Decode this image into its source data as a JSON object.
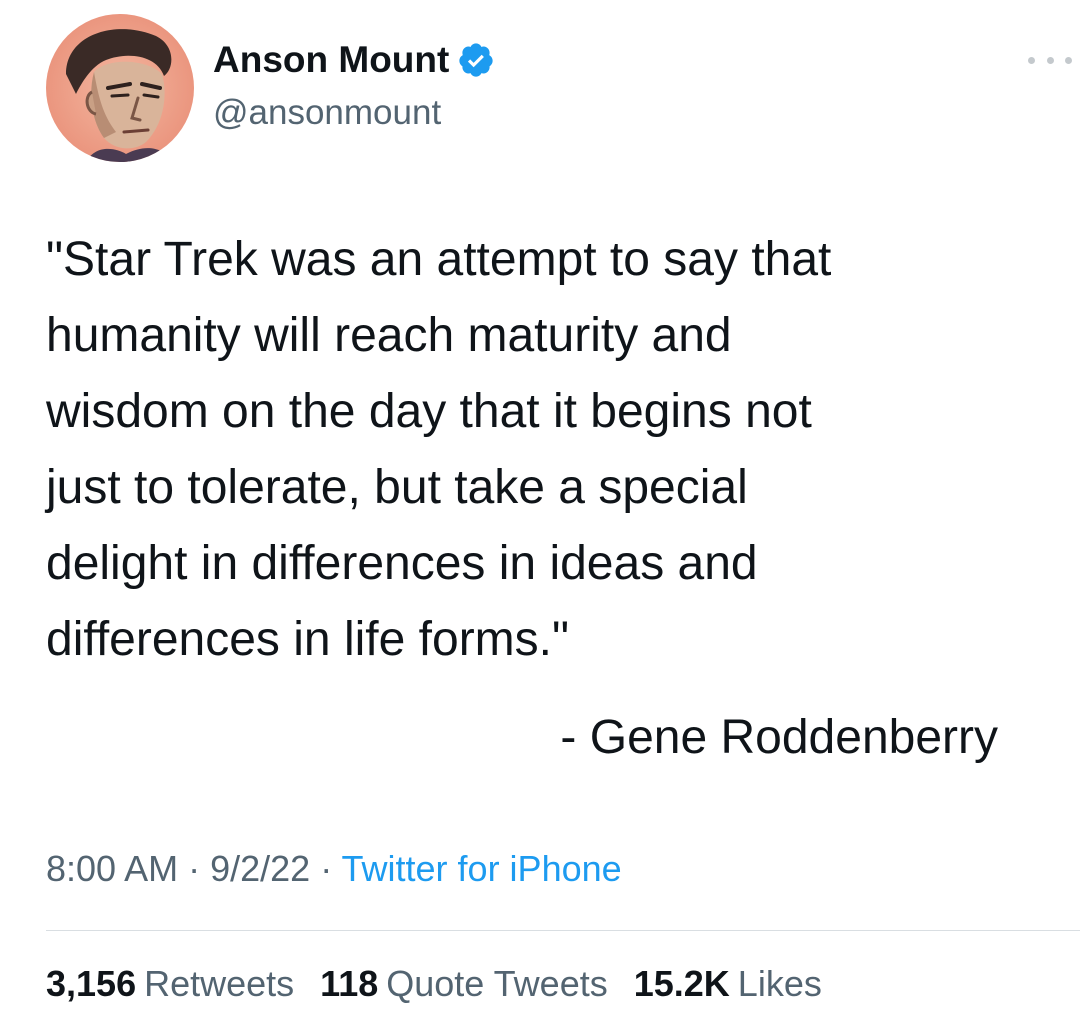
{
  "author": {
    "name": "Anson Mount",
    "handle": "@ansonmount",
    "verified": true,
    "avatar_icon": "profile-illustration",
    "verified_icon": "verified-badge-icon"
  },
  "tweet": {
    "text": "\"Star Trek was an attempt to say that\nhumanity will reach maturity and\nwisdom on the day that it begins not\njust to tolerate, but take a special\ndelight in differences in ideas and\ndifferences in life forms.\"",
    "attribution": "- Gene Roddenberry"
  },
  "meta": {
    "time": "8:00 AM",
    "separator": " · ",
    "date": "9/2/22",
    "source": "Twitter for iPhone"
  },
  "stats": {
    "retweets_count": "3,156",
    "retweets_label": "Retweets",
    "quotes_count": "118",
    "quotes_label": "Quote Tweets",
    "likes_count": "15.2K",
    "likes_label": "Likes"
  },
  "colors": {
    "text": "#0f1419",
    "secondary": "#536471",
    "accent": "#1d9bf0",
    "divider": "#d9dee2"
  }
}
